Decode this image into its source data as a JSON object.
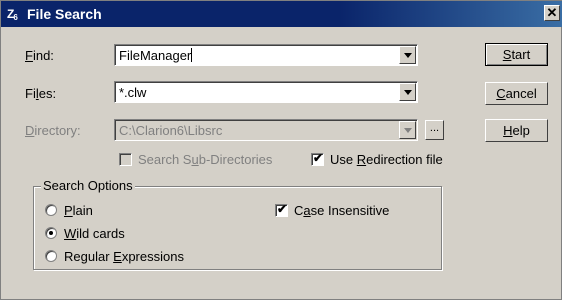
{
  "window": {
    "title": "File Search",
    "icon_text": "Z",
    "icon_sub": "6",
    "close_glyph": "✕"
  },
  "find": {
    "label_pre": "",
    "label_key": "F",
    "label_post": "ind:",
    "value": "FileManager"
  },
  "files": {
    "label_pre": "Fi",
    "label_key": "l",
    "label_post": "es:",
    "value": "*.clw"
  },
  "directory": {
    "label_pre": "",
    "label_key": "D",
    "label_post": "irectory:",
    "value": "C:\\Clarion6\\Libsrc",
    "browse_label": "..."
  },
  "options": {
    "search_subdirs": {
      "label_pre": "Search S",
      "label_key": "u",
      "label_post": "b-Directories",
      "checked": false,
      "enabled": false
    },
    "use_redirection": {
      "label_pre": "Use ",
      "label_key": "R",
      "label_post": "edirection file",
      "checked": true,
      "enabled": true
    }
  },
  "buttons": {
    "start": {
      "pre": "",
      "key": "S",
      "post": "tart"
    },
    "cancel": {
      "pre": "",
      "key": "C",
      "post": "ancel"
    },
    "help": {
      "pre": "",
      "key": "H",
      "post": "elp"
    }
  },
  "search_options": {
    "title": "Search Options",
    "modes": [
      {
        "pre": "",
        "key": "P",
        "post": "lain",
        "selected": false
      },
      {
        "pre": "",
        "key": "W",
        "post": "ild cards",
        "selected": true
      },
      {
        "pre": "Regular ",
        "key": "E",
        "post": "xpressions",
        "selected": false
      }
    ],
    "case_insensitive": {
      "pre": "C",
      "key": "a",
      "post": "se Insensitive",
      "checked": true
    }
  },
  "glyphs": {
    "checkmark": "✔",
    "dropdown": "chevron-down-icon"
  }
}
